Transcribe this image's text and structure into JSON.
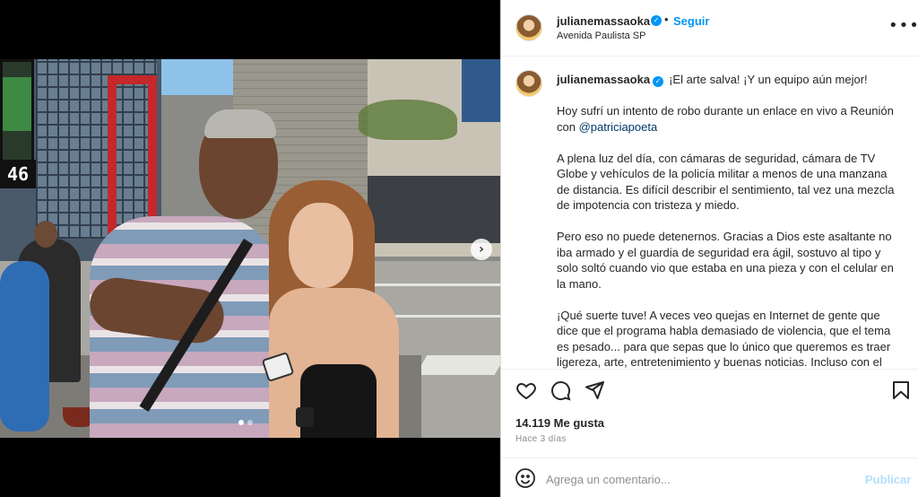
{
  "post": {
    "username": "julianemassaoka",
    "verified_icon": "verified-badge-icon",
    "follow_label": "Seguir",
    "bullet": "•",
    "location": "Avenida Paulista SP",
    "more_icon": "more-horizontal-icon"
  },
  "media": {
    "clock_text": "46",
    "carousel_current": 1,
    "carousel_total": 2,
    "next_icon": "chevron-right-icon"
  },
  "caption": {
    "username": "julianemassaoka",
    "first_line": "¡El arte salva! ¡Y un equipo aún mejor!",
    "p2_text": "Hoy sufrí un intento de robo durante un enlace en vivo a Reunión con ",
    "p2_mention": "@patriciapoeta",
    "p3": "A plena luz del día, con cámaras de seguridad, cámara de TV Globe y vehículos de la policía militar a menos de una manzana de distancia. Es difícil describir el sentimiento, tal vez una mezcla de impotencia con tristeza y miedo.",
    "p4": "Pero eso no puede detenernos. Gracias a Dios este asaltante no iba armado y el guardia de seguridad era ágil, sostuvo al tipo y solo soltó cuando vio que estaba en una pieza y con el celular en la mano.",
    "p5": "¡Qué suerte tuve! A veces veo quejas en Internet de gente que dice que el programa habla demasiado de violencia, que el tema es pesado... para que sepas que lo único que queremos es traer ligereza, arte, entretenimiento y buenas noticias. Incluso con el"
  },
  "actions": {
    "like_icon": "heart-icon",
    "comment_icon": "comment-icon",
    "share_icon": "send-icon",
    "save_icon": "bookmark-icon",
    "likes": "14.119 Me gusta",
    "time": "Hace 3 días"
  },
  "comment": {
    "emoji_icon": "emoji-icon",
    "placeholder": "Agrega un comentario...",
    "publish_label": "Publicar"
  },
  "colors": {
    "accent": "#0095f6",
    "publish_disabled": "#b2dffc",
    "mention": "#00376b"
  }
}
